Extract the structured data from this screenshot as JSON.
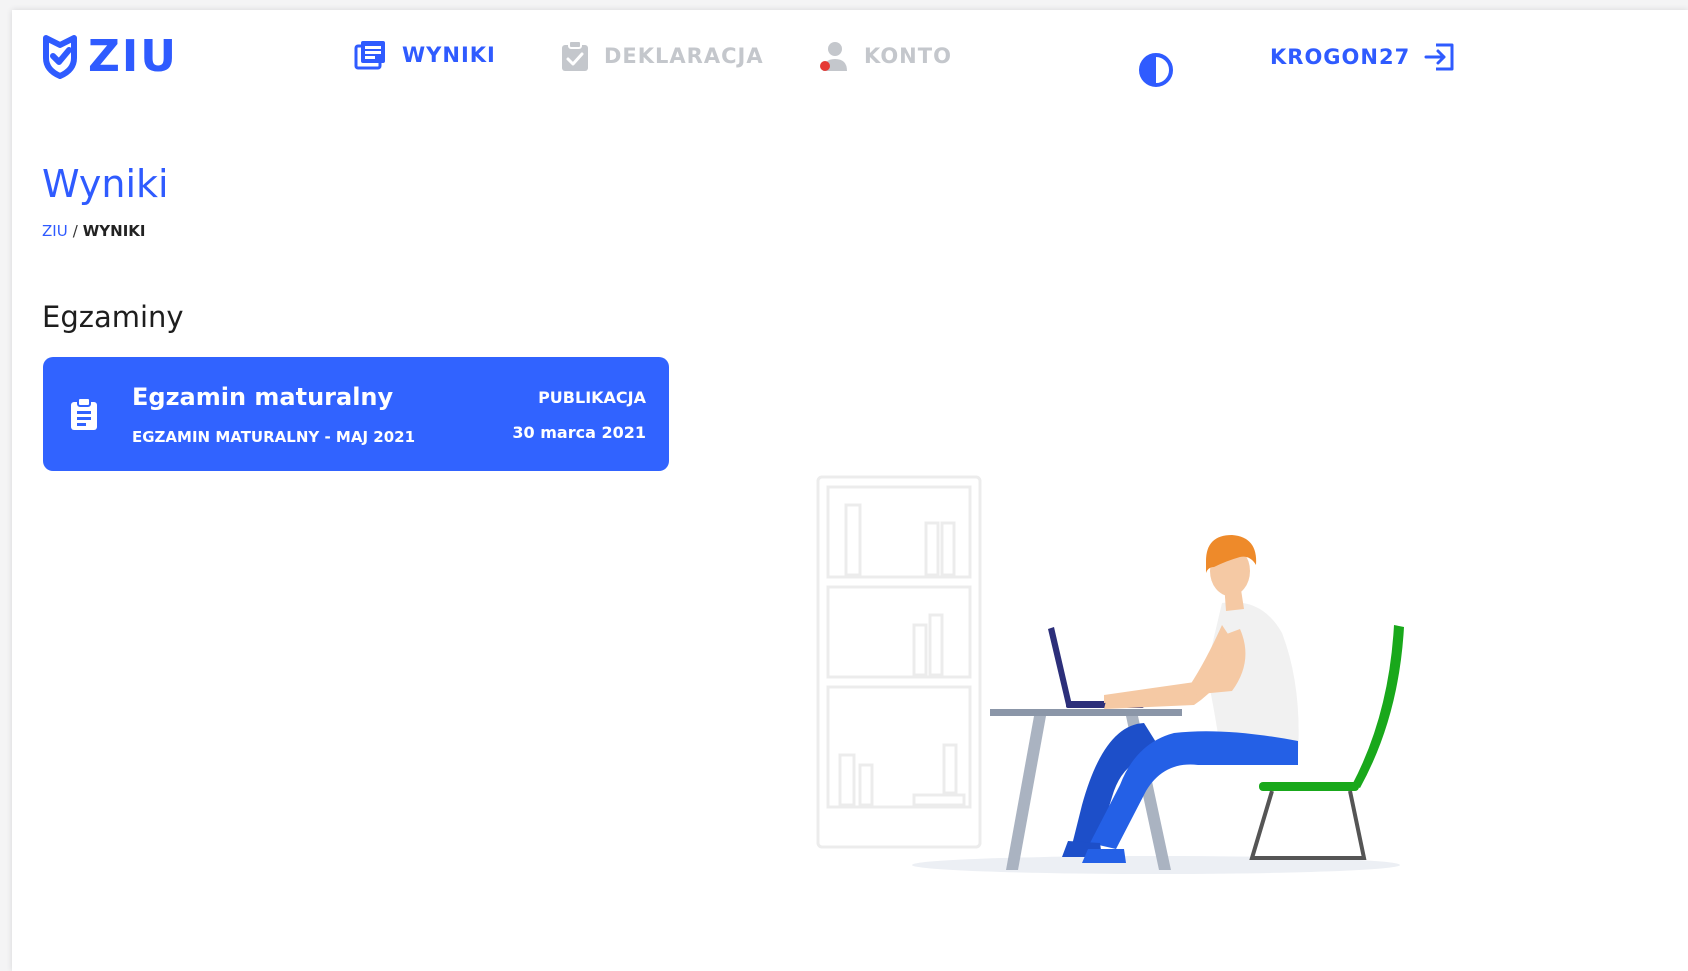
{
  "app": {
    "logo_text": "ZIU"
  },
  "nav": {
    "wyniki": "WYNIKI",
    "deklaracja": "DEKLARACJA",
    "konto": "KONTO"
  },
  "user": {
    "name": "KROGON27"
  },
  "page": {
    "title": "Wyniki"
  },
  "breadcrumb": {
    "root": "ZIU",
    "separator": "/",
    "current": "WYNIKI"
  },
  "section": {
    "title": "Egzaminy"
  },
  "exam_card": {
    "title": "Egzamin maturalny",
    "subtitle": "EGZAMIN MATURALNY - MAJ 2021",
    "label": "PUBLIKACJA",
    "date": "30 marca 2021"
  },
  "icons": {
    "logo": "shield-check-icon",
    "wyniki": "newspaper-icon",
    "deklaracja": "clipboard-check-icon",
    "konto": "user-icon",
    "contrast": "contrast-icon",
    "logout": "logout-icon",
    "card": "clipboard-list-icon"
  },
  "colors": {
    "primary": "#2f5bff",
    "card_bg": "#3163ff",
    "inactive_nav": "#c4c7cc",
    "badge_red": "#e53935"
  }
}
